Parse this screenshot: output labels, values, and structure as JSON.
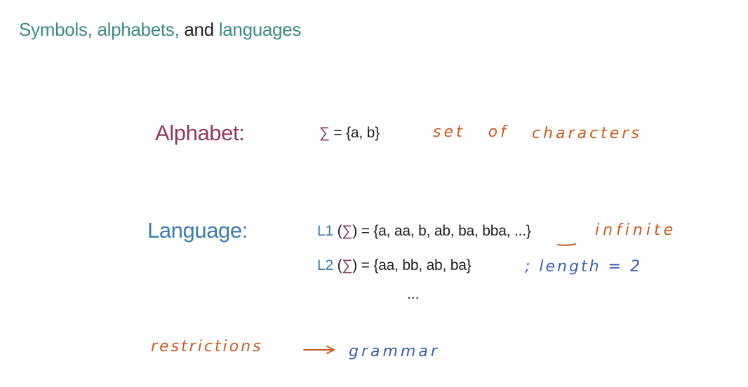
{
  "title": {
    "part1": "Symbols, alphabets,",
    "part2": "and",
    "part3": "languages"
  },
  "alphabet": {
    "label": "Alphabet:",
    "sigma": "∑",
    "definition": "= {a, b}",
    "annotation_part1": "set of",
    "annotation_part2": "characters"
  },
  "language": {
    "label": "Language:",
    "l1_name": "L1",
    "l1_open": " (",
    "l1_sigma": "∑",
    "l1_definition": ") = {a, aa, b, ab, ba, bba, ...}",
    "l1_annotation": "infinite",
    "l2_name": "L2",
    "l2_open": " (",
    "l2_sigma": "∑",
    "l2_definition": ") = {aa, bb, ab, ba}",
    "l2_annotation": "; length = 2",
    "more": "..."
  },
  "bottom": {
    "left_word": "restrictions",
    "arrow": "→",
    "right_word": "grammar"
  },
  "colors": {
    "title_teal": "#3e8a86",
    "alphabet": "#8c3a63",
    "language": "#3d7cae",
    "handwriting_orange": "#cc5a1f",
    "handwriting_blue": "#3a5fb5"
  }
}
